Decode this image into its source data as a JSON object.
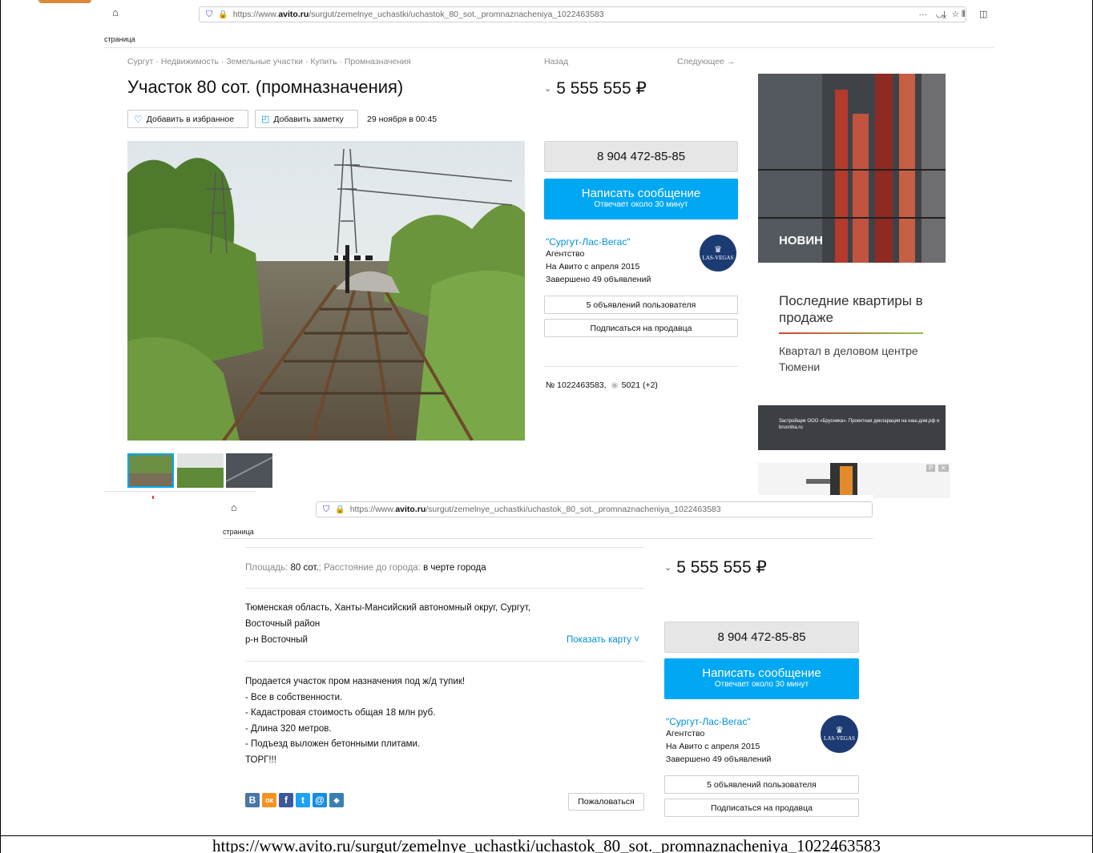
{
  "caption": "https://www.avito.ru/surgut/zemelnye_uchastki/uchastok_80_sot._promnaznacheniya_1022463583",
  "shot1": {
    "browser": {
      "url_prefix": "https://www.",
      "url_domain": "avito.ru",
      "url_path": "/surgut/zemelnye_uchastki/uchastok_80_sot._promnaznacheniya_1022463583",
      "tab_text": "страница",
      "home_icon": "home-icon",
      "more_glyph": "···"
    },
    "breadcrumbs": "Сургут · Недвижимость · Земельные участки · Купить · Промназначения",
    "nav": {
      "back": "Назад",
      "next": "Следующее →"
    },
    "title": "Участок 80 сот. (промназначения)",
    "price": "5 555 555 ₽",
    "actions": {
      "favorite": "Добавить в избранное",
      "note": "Добавить заметку",
      "date": "29 ноября в 00:45"
    },
    "phone": "8 904 472-85-85",
    "message": {
      "label": "Написать сообщение",
      "sub": "Отвечает около 30 минут"
    },
    "seller": {
      "name": "\"Сургут-Лас-Вегас\"",
      "type": "Агентство",
      "since": "На Авито с апреля 2015",
      "completed": "Завершено 49 объявлений",
      "logo_text": "LAS-VEGAS"
    },
    "user_ads": "5 объявлений пользователя",
    "subscribe": "Подписаться на продавца",
    "item_no": "№ 1022463583,",
    "views": "5021 (+2)",
    "ad": {
      "badge": "НОВИН",
      "headline": "Последние квартиры в продаже",
      "sub": "Квартал в деловом центре Тюмени",
      "fine_print": "Застройщик ООО «Брусника». Проектная декларация на наш.дом.рф и brusnika.ru"
    },
    "small_ad_badge": "P",
    "small_ad_close": "✕"
  },
  "shot2": {
    "browser": {
      "url_prefix": "https://www.",
      "url_domain": "avito.ru",
      "url_path": "/surgut/zemelnye_uchastki/uchastok_80_sot._promnaznacheniya_1022463583",
      "tab_text": "страница"
    },
    "params": {
      "area_label": "Площадь:",
      "area_value": "80 сот.",
      "sep": ";",
      "distance_label": "Расстояние до города:",
      "distance_value": "в черте города"
    },
    "address": {
      "line1": "Тюменская область, Ханты-Мансийский автономный округ, Сургут,",
      "line2": "Восточный район",
      "line3": "р-н Восточный",
      "map_link": "Показать карту ˅"
    },
    "description": [
      "Продается участок пром назначения под ж/д тупик!",
      "- Все в собственности.",
      "- Кадастровая стоимость общая 18 млн руб.",
      "- Длина 320 метров.",
      "- Подъезд выложен бетонными плитами.",
      "ТОРГ!!!"
    ],
    "share": [
      "В",
      "ок",
      "f",
      "t",
      "@",
      "◆"
    ],
    "share_colors": [
      "#4a76a8",
      "#f7931e",
      "#3b5998",
      "#1da1f2",
      "#168de2",
      "#3b7fb1"
    ],
    "complain": "Пожаловаться",
    "price": "5 555 555 ₽",
    "phone": "8 904 472-85-85",
    "message": {
      "label": "Написать сообщение",
      "sub": "Отвечает около 30 минут"
    },
    "seller": {
      "name": "\"Сургут-Лас-Вегас\"",
      "type": "Агентство",
      "since": "На Авито с апреля 2015",
      "completed": "Завершено 49 объявлений",
      "logo_text": "LAS-VEGAS"
    },
    "user_ads": "5 объявлений пользователя",
    "subscribe": "Подписаться на продавца"
  }
}
